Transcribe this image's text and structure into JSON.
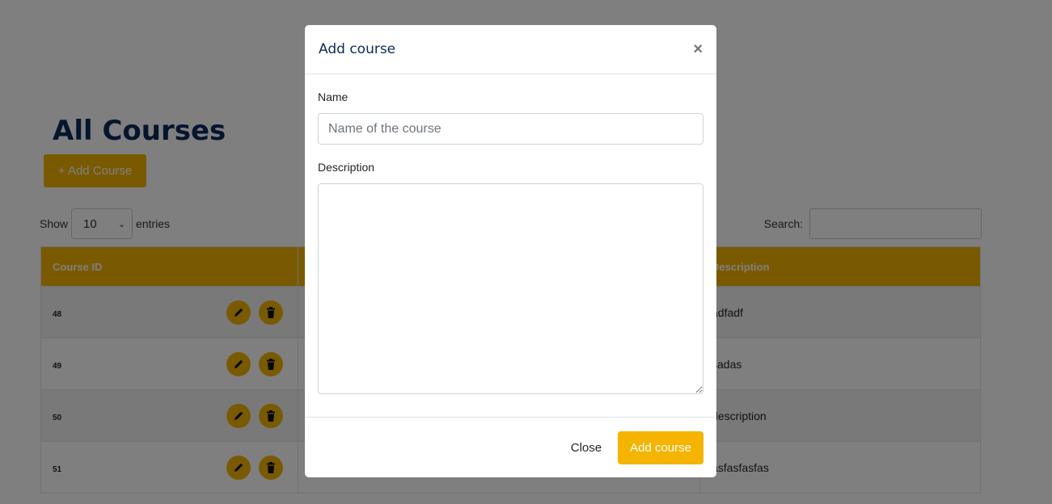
{
  "page": {
    "title": "All Courses",
    "add_button": "+ Add Course",
    "show_label": "Show",
    "entries_value": "10",
    "entries_label": "entries",
    "search_label": "Search:"
  },
  "table": {
    "headers": [
      "Course ID",
      "",
      "Description"
    ],
    "rows": [
      {
        "id": "48",
        "description": "adfadf"
      },
      {
        "id": "49",
        "description": "sadas"
      },
      {
        "id": "50",
        "description": "description"
      },
      {
        "id": "51",
        "description": "asfasfasfas"
      }
    ]
  },
  "modal": {
    "title": "Add course",
    "name_label": "Name",
    "name_placeholder": "Name of the course",
    "description_label": "Description",
    "close_label": "Close",
    "submit_label": "Add course"
  },
  "colors": {
    "accent": "#f5b400",
    "title": "#0d2a5c",
    "overlay": "rgba(0,0,0,0.5)"
  }
}
